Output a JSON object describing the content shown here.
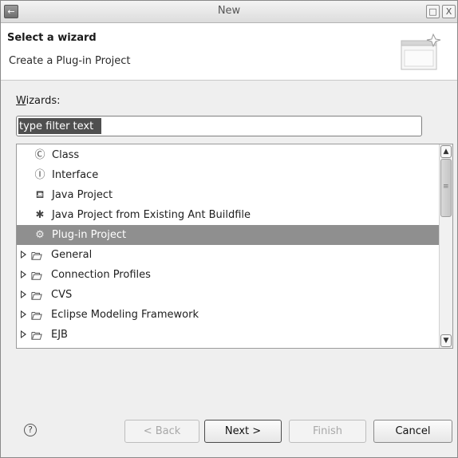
{
  "window": {
    "title": "New",
    "app_icon": "←",
    "maximize_glyph": "□",
    "close_glyph": "X"
  },
  "header": {
    "title": "Select a wizard",
    "description": "Create a Plug-in Project"
  },
  "wizards": {
    "label_mnemonic": "W",
    "label_rest": "izards:",
    "filter_value": "type filter text"
  },
  "tree": {
    "items": [
      {
        "label": "Class",
        "kind": "leaf",
        "icon": "class-icon",
        "glyph": "Ⓒ"
      },
      {
        "label": "Interface",
        "kind": "leaf",
        "icon": "interface-icon",
        "glyph": "Ⓘ"
      },
      {
        "label": "Java Project",
        "kind": "leaf",
        "icon": "java-project-icon",
        "glyph": "⛾"
      },
      {
        "label": "Java Project from Existing Ant Buildfile",
        "kind": "leaf",
        "icon": "ant-icon",
        "glyph": "✱"
      },
      {
        "label": "Plug-in Project",
        "kind": "leaf",
        "icon": "plugin-project-icon",
        "glyph": "⚙",
        "selected": true
      },
      {
        "label": "General",
        "kind": "folder",
        "icon": "folder-icon"
      },
      {
        "label": "Connection Profiles",
        "kind": "folder",
        "icon": "folder-icon"
      },
      {
        "label": "CVS",
        "kind": "folder",
        "icon": "folder-icon"
      },
      {
        "label": "Eclipse Modeling Framework",
        "kind": "folder",
        "icon": "folder-icon"
      },
      {
        "label": "EJB",
        "kind": "folder",
        "icon": "folder-icon"
      }
    ]
  },
  "scrollbar": {
    "up_glyph": "▲",
    "down_glyph": "▼"
  },
  "footer": {
    "help_glyph": "?",
    "back_label": "< Back",
    "next_label": "Next >",
    "finish_label": "Finish",
    "cancel_label": "Cancel"
  }
}
